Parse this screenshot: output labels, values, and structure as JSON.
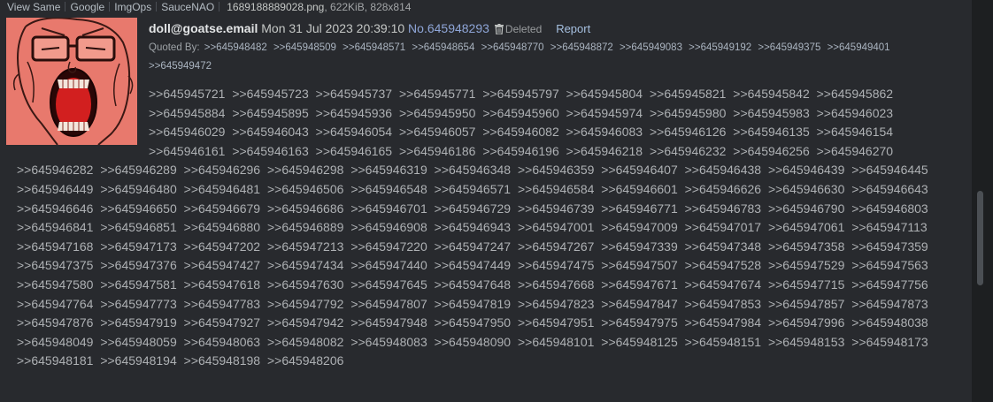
{
  "file_bar": {
    "links": [
      "View Same",
      "Google",
      "ImgOps",
      "SauceNAO"
    ],
    "filename": "1689188889028.png",
    "file_meta": ", 622KiB, 828x814"
  },
  "thumbnail": {
    "icon": "wojak-screaming-image"
  },
  "post": {
    "name": "doll@goatse.email",
    "datetime": "Mon 31 Jul 2023 20:39:10",
    "post_no": "No.645948293",
    "deleted_label": "Deleted",
    "report_label": "Report"
  },
  "quoted_by": {
    "label": "Quoted By:",
    "refs": [
      ">>645948482",
      ">>645948509",
      ">>645948571",
      ">>645948654",
      ">>645948770",
      ">>645948872",
      ">>645949083",
      ">>645949192",
      ">>645949375",
      ">>645949401",
      ">>645949472"
    ]
  },
  "body_refs": [
    ">>645945721",
    ">>645945723",
    ">>645945737",
    ">>645945771",
    ">>645945797",
    ">>645945804",
    ">>645945821",
    ">>645945842",
    ">>645945862",
    ">>645945884",
    ">>645945895",
    ">>645945936",
    ">>645945950",
    ">>645945960",
    ">>645945974",
    ">>645945980",
    ">>645945983",
    ">>645946023",
    ">>645946029",
    ">>645946043",
    ">>645946054",
    ">>645946057",
    ">>645946082",
    ">>645946083",
    ">>645946126",
    ">>645946135",
    ">>645946154",
    ">>645946161",
    ">>645946163",
    ">>645946165",
    ">>645946186",
    ">>645946196",
    ">>645946218",
    ">>645946232",
    ">>645946256",
    ">>645946270",
    ">>645946282",
    ">>645946289",
    ">>645946296",
    ">>645946298",
    ">>645946319",
    ">>645946348",
    ">>645946359",
    ">>645946407",
    ">>645946438",
    ">>645946439",
    ">>645946445",
    ">>645946449",
    ">>645946480",
    ">>645946481",
    ">>645946506",
    ">>645946548",
    ">>645946571",
    ">>645946584",
    ">>645946601",
    ">>645946626",
    ">>645946630",
    ">>645946643",
    ">>645946646",
    ">>645946650",
    ">>645946679",
    ">>645946686",
    ">>645946701",
    ">>645946729",
    ">>645946739",
    ">>645946771",
    ">>645946783",
    ">>645946790",
    ">>645946803",
    ">>645946841",
    ">>645946851",
    ">>645946880",
    ">>645946889",
    ">>645946908",
    ">>645946943",
    ">>645947001",
    ">>645947009",
    ">>645947017",
    ">>645947061",
    ">>645947113",
    ">>645947168",
    ">>645947173",
    ">>645947202",
    ">>645947213",
    ">>645947220",
    ">>645947247",
    ">>645947267",
    ">>645947339",
    ">>645947348",
    ">>645947358",
    ">>645947359",
    ">>645947375",
    ">>645947376",
    ">>645947427",
    ">>645947434",
    ">>645947440",
    ">>645947449",
    ">>645947475",
    ">>645947507",
    ">>645947528",
    ">>645947529",
    ">>645947563",
    ">>645947580",
    ">>645947581",
    ">>645947618",
    ">>645947630",
    ">>645947645",
    ">>645947648",
    ">>645947668",
    ">>645947671",
    ">>645947674",
    ">>645947715",
    ">>645947756",
    ">>645947764",
    ">>645947773",
    ">>645947783",
    ">>645947792",
    ">>645947807",
    ">>645947819",
    ">>645947823",
    ">>645947847",
    ">>645947853",
    ">>645947857",
    ">>645947873",
    ">>645947876",
    ">>645947919",
    ">>645947927",
    ">>645947942",
    ">>645947948",
    ">>645947950",
    ">>645947951",
    ">>645947975",
    ">>645947984",
    ">>645947996",
    ">>645948038",
    ">>645948049",
    ">>645948059",
    ">>645948063",
    ">>645948082",
    ">>645948083",
    ">>645948090",
    ">>645948101",
    ">>645948125",
    ">>645948151",
    ">>645948153",
    ">>645948173",
    ">>645948181",
    ">>645948194",
    ">>645948198",
    ">>645948206"
  ],
  "colors": {
    "post_bg": "#282a2e",
    "page_bg": "#1d1f21",
    "link": "#8fa6d8",
    "thumbnail_bg": "#e87a6e"
  }
}
